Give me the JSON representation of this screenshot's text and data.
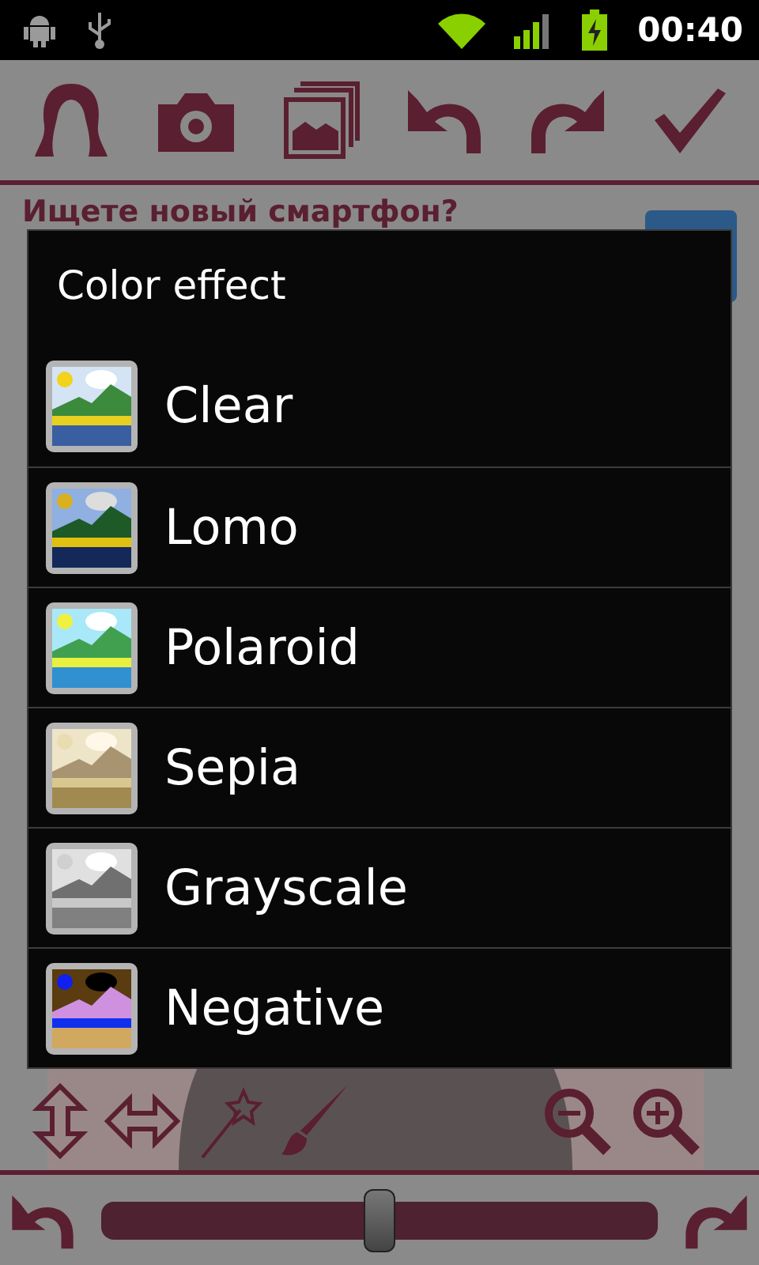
{
  "status_bar": {
    "time": "00:40"
  },
  "ad": {
    "headline": "Ищете новый смартфон?"
  },
  "dialog": {
    "title": "Color effect",
    "items": [
      {
        "label": "Clear",
        "kind": "clear"
      },
      {
        "label": "Lomo",
        "kind": "lomo"
      },
      {
        "label": "Polaroid",
        "kind": "polaroid"
      },
      {
        "label": "Sepia",
        "kind": "sepia"
      },
      {
        "label": "Grayscale",
        "kind": "grayscale"
      },
      {
        "label": "Negative",
        "kind": "negative"
      }
    ]
  },
  "slider": {
    "level": 0.5
  }
}
